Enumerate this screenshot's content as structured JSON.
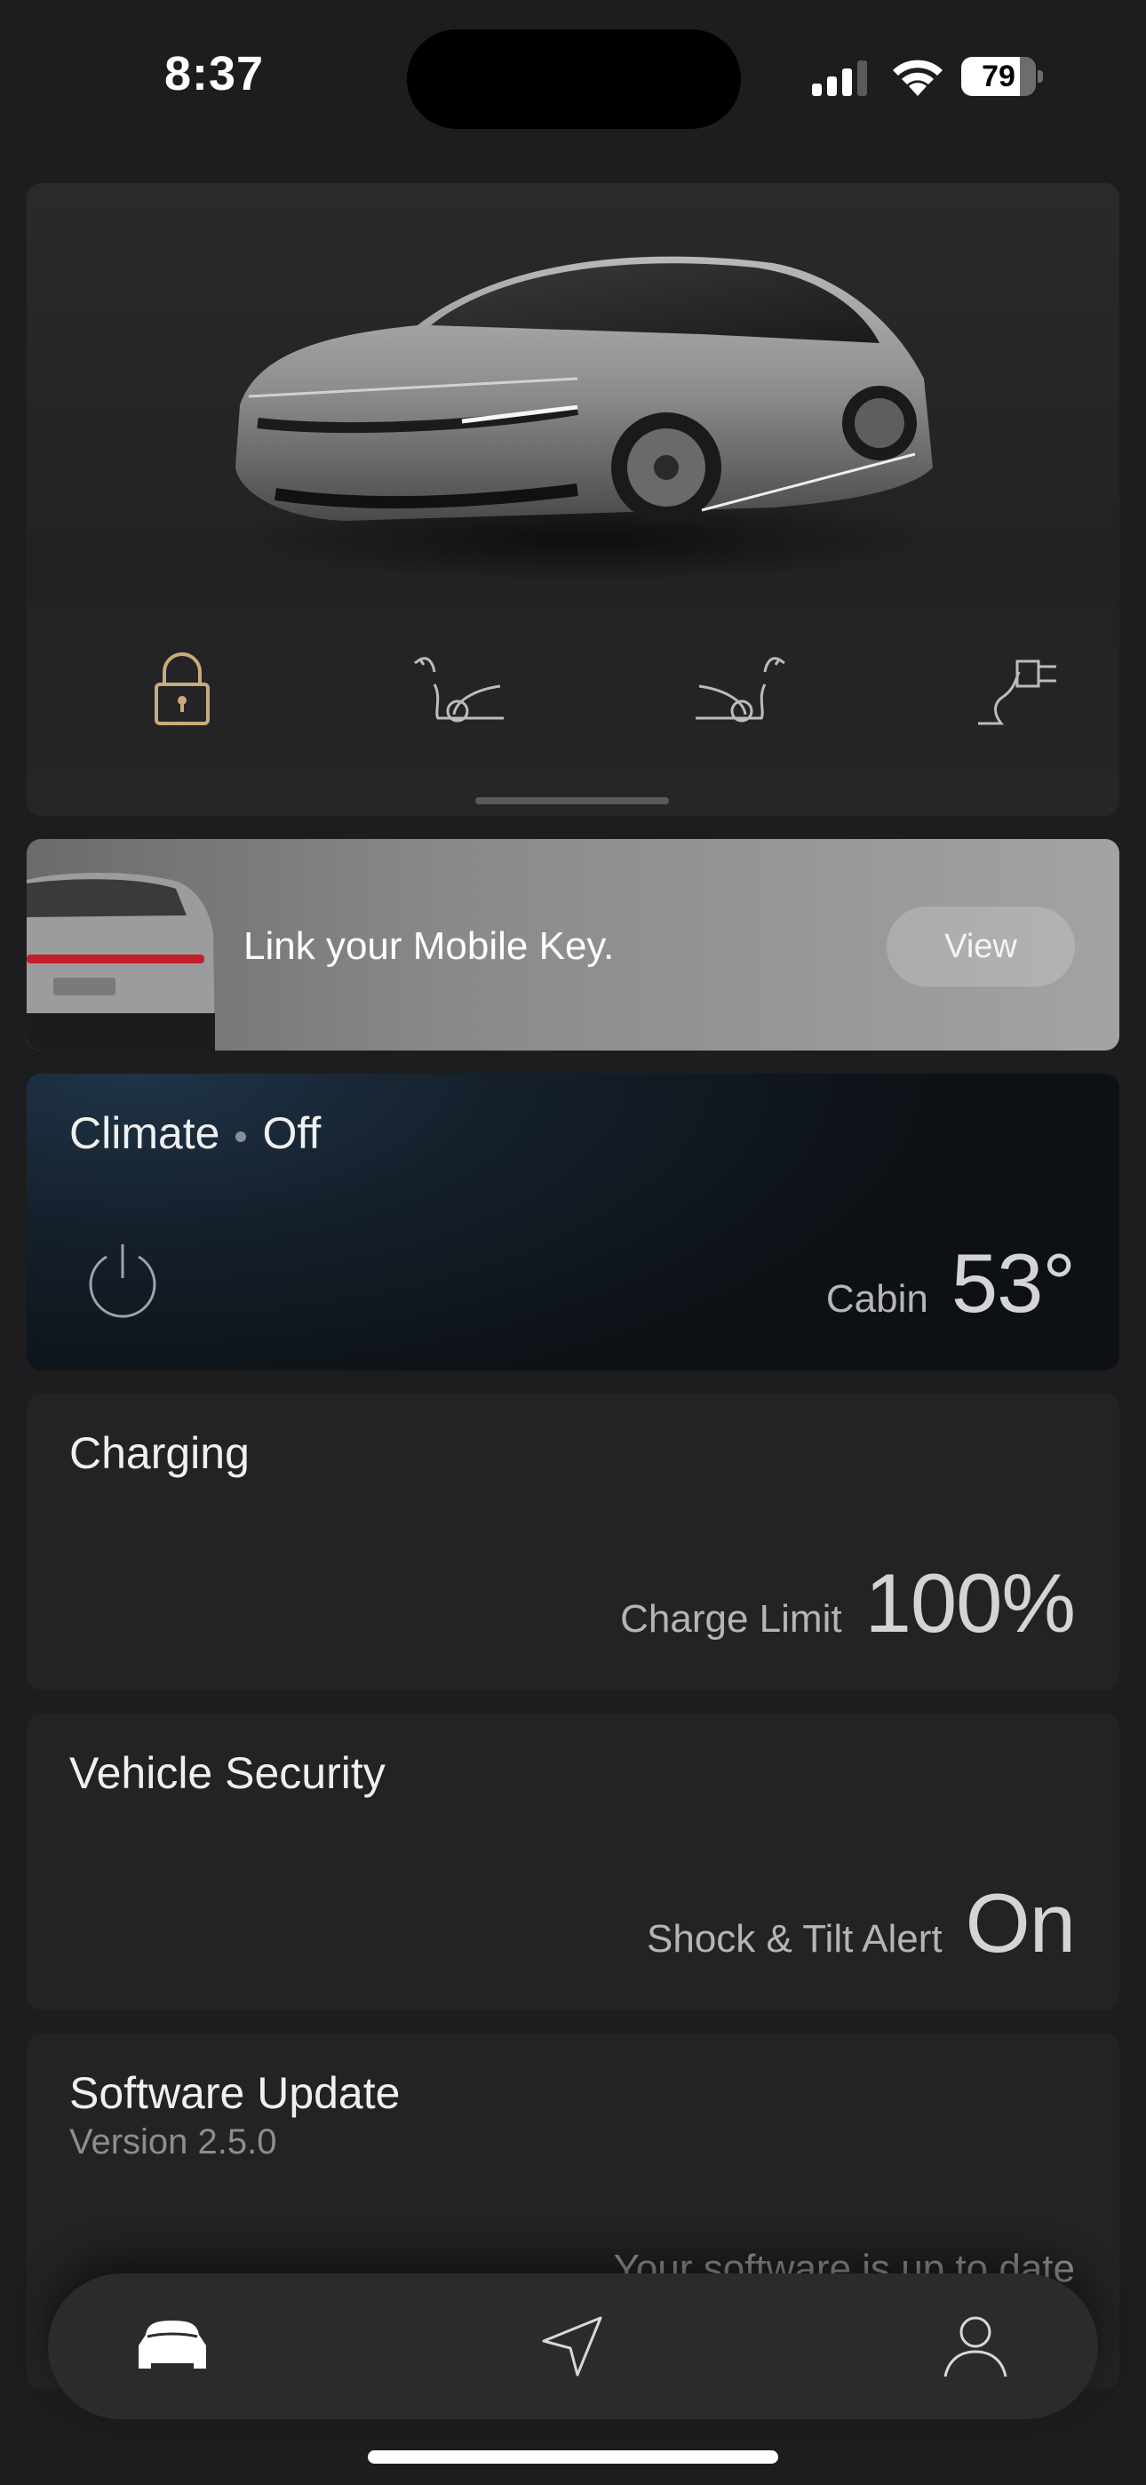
{
  "status_bar": {
    "time": "8:37",
    "battery_level": "79"
  },
  "hero": {
    "controls": [
      {
        "name": "lock",
        "icon": "padlock-icon"
      },
      {
        "name": "frunk",
        "icon": "frunk-open-icon"
      },
      {
        "name": "trunk",
        "icon": "trunk-open-icon"
      },
      {
        "name": "charge-port",
        "icon": "charge-plug-icon"
      }
    ]
  },
  "mobile_key": {
    "message": "Link your Mobile Key.",
    "button_label": "View"
  },
  "climate": {
    "title": "Climate",
    "state": "Off",
    "metric_label": "Cabin",
    "metric_value": "53°"
  },
  "charging": {
    "title": "Charging",
    "metric_label": "Charge Limit",
    "metric_value": "100%"
  },
  "security": {
    "title": "Vehicle Security",
    "metric_label": "Shock & Tilt Alert",
    "metric_value": "On"
  },
  "software": {
    "title": "Software Update",
    "version": "Version 2.5.0",
    "status": "Your software is up to date"
  },
  "tab_bar": {
    "tabs": [
      {
        "name": "vehicle",
        "icon": "car-icon",
        "active": true
      },
      {
        "name": "navigation",
        "icon": "navigation-arrow-icon",
        "active": false
      },
      {
        "name": "profile",
        "icon": "person-icon",
        "active": false
      }
    ]
  },
  "colors": {
    "background": "#1d1d1f",
    "card": "#232325",
    "lock_accent": "#c9ab7c",
    "climate_gradient": "#1f3447"
  }
}
